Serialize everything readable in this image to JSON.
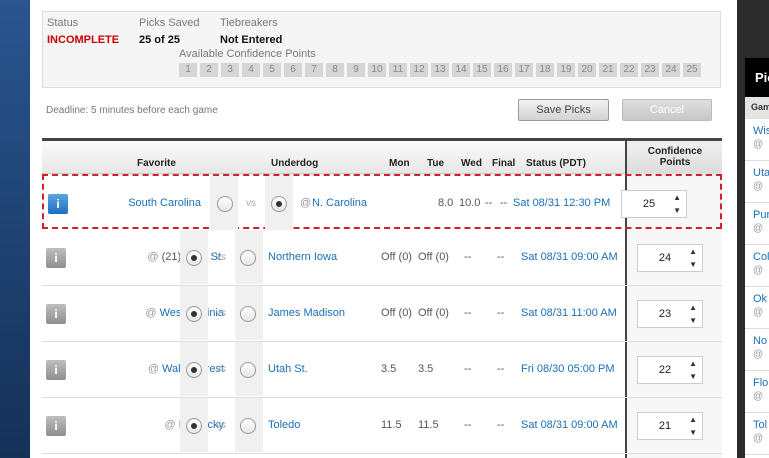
{
  "summary": {
    "status_label": "Status",
    "status_value": "INCOMPLETE",
    "picks_label": "Picks Saved",
    "picks_value": "25 of 25",
    "tiebreakers_label": "Tiebreakers",
    "tiebreakers_value": "Not Entered",
    "available_label": "Available Confidence Points",
    "points": [
      "1",
      "2",
      "3",
      "4",
      "5",
      "6",
      "7",
      "8",
      "9",
      "10",
      "11",
      "12",
      "13",
      "14",
      "15",
      "16",
      "17",
      "18",
      "19",
      "20",
      "21",
      "22",
      "23",
      "24",
      "25"
    ]
  },
  "deadline": "Deadline: 5 minutes before each game",
  "buttons": {
    "save": "Save Picks",
    "cancel": "Cancel"
  },
  "headers": {
    "favorite": "Favorite",
    "underdog": "Underdog",
    "mon": "Mon",
    "tue": "Tue",
    "wed": "Wed",
    "final": "Final",
    "status": "Status (PDT)",
    "confidence": "Confidence Points"
  },
  "games": [
    {
      "fav_at": "",
      "fav_rank": "",
      "favorite": "South Carolina",
      "fav_picked": false,
      "vs": "vs",
      "dog_at": "@",
      "underdog": "N. Carolina",
      "dog_picked": true,
      "mon": "",
      "tue": "8.0",
      "wed": "10.0",
      "wed2": "--",
      "final": "--",
      "status": "Sat 08/31 12:30 PM",
      "confidence": "25"
    },
    {
      "fav_at": "@",
      "fav_rank": "(21)",
      "favorite": "Iowa St.",
      "fav_picked": true,
      "vs": "vs",
      "dog_at": "",
      "underdog": "Northern Iowa",
      "dog_picked": false,
      "mon": "Off (0)",
      "tue": "Off (0)",
      "wed": "--",
      "final": "--",
      "status": "Sat 08/31 09:00 AM",
      "confidence": "24"
    },
    {
      "fav_at": "@",
      "fav_rank": "",
      "favorite": "West Virginia",
      "fav_picked": true,
      "vs": "vs",
      "dog_at": "",
      "underdog": "James Madison",
      "dog_picked": false,
      "mon": "Off (0)",
      "tue": "Off (0)",
      "wed": "--",
      "final": "--",
      "status": "Sat 08/31 11:00 AM",
      "confidence": "23"
    },
    {
      "fav_at": "@",
      "fav_rank": "",
      "favorite": "Wake Forest",
      "fav_picked": true,
      "vs": "vs",
      "dog_at": "",
      "underdog": "Utah St.",
      "dog_picked": false,
      "mon": "3.5",
      "tue": "3.5",
      "wed": "--",
      "final": "--",
      "status": "Fri 08/30 05:00 PM",
      "confidence": "22"
    },
    {
      "fav_at": "@",
      "fav_rank": "",
      "favorite": "Kentucky",
      "fav_picked": true,
      "vs": "vs",
      "dog_at": "",
      "underdog": "Toledo",
      "dog_picked": false,
      "mon": "11.5",
      "tue": "11.5",
      "wed": "--",
      "final": "--",
      "status": "Sat 08/31 09:00 AM",
      "confidence": "21"
    }
  ],
  "side_panel": {
    "title": "Pic",
    "subhead": "Gam",
    "rows": [
      {
        "a": "Wis",
        "b": "@"
      },
      {
        "a": "Uta",
        "b": "@"
      },
      {
        "a": "Pur",
        "b": "@"
      },
      {
        "a": "Col",
        "b": "@"
      },
      {
        "a": "Ok",
        "b": "@"
      },
      {
        "a": "No",
        "b": "@"
      },
      {
        "a": "Flo",
        "b": "@"
      },
      {
        "a": "Tol",
        "b": "@"
      }
    ]
  },
  "info_glyph": "i"
}
